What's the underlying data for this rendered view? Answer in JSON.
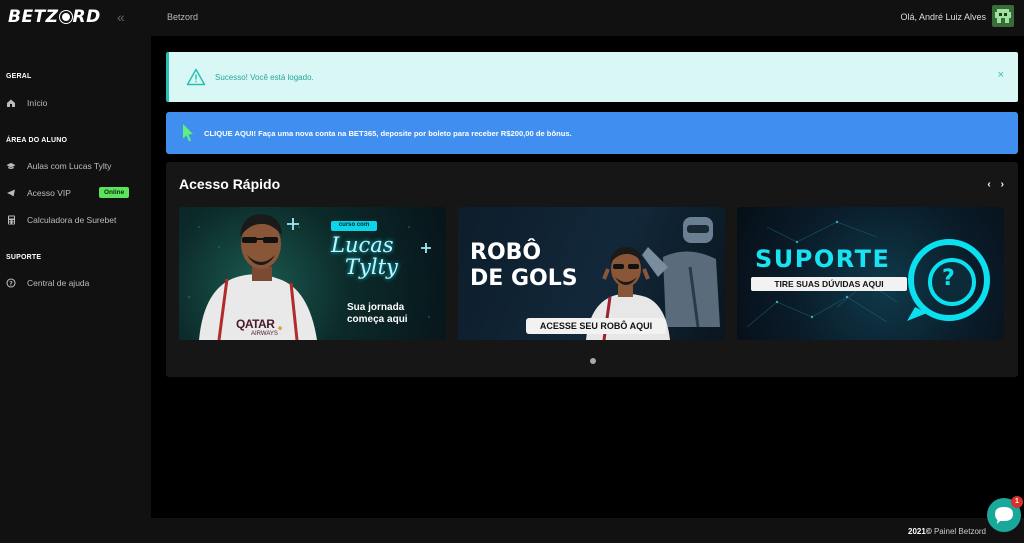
{
  "brand": {
    "logo_pre": "BETZ",
    "logo_post": "RD"
  },
  "header": {
    "breadcrumb": "Betzord",
    "greeting": "Olá, André Luiz Alves",
    "collapse_glyph": "«"
  },
  "sidebar": {
    "sections": [
      {
        "title": "GERAL",
        "items": [
          {
            "label": "Início",
            "icon": "home-icon"
          }
        ]
      },
      {
        "title": "ÁREA DO ALUNO",
        "items": [
          {
            "label": "Aulas com Lucas Tylty",
            "icon": "graduation-cap-icon"
          },
          {
            "label": "Acesso VIP",
            "icon": "telegram-icon",
            "badge": "Online"
          },
          {
            "label": "Calculadora de Surebet",
            "icon": "calculator-icon"
          }
        ]
      },
      {
        "title": "SUPORTE",
        "items": [
          {
            "label": "Central de ajuda",
            "icon": "help-circle-icon"
          }
        ]
      }
    ]
  },
  "alerts": {
    "success": {
      "message": "Sucesso! Você está logado.",
      "close": "×"
    },
    "promo": {
      "message": "CLIQUE AQUI! Faça uma nova conta na BET365, deposite por boleto para receber R$200,00 de bônus."
    }
  },
  "quick_access": {
    "title": "Acesso Rápido",
    "prev": "‹",
    "next": "›",
    "cards": [
      {
        "tag": "curso com",
        "name_1": "Lucas",
        "name_2": "Tylty",
        "caption_1": "Sua jornada",
        "caption_2": "começa aqui",
        "shirt": "QATAR",
        "shirt_sub": "AIRWAYS"
      },
      {
        "title_1": "ROBÔ",
        "title_2": "DE GOLS",
        "button": "ACESSE SEU ROBÔ AQUI"
      },
      {
        "title": "SUPORTE",
        "subtitle": "TIRE SUAS DÚVIDAS AQUI",
        "symbol": "?"
      }
    ]
  },
  "footer": {
    "year": "2021©",
    "owner": "Painel Betzord"
  },
  "chat": {
    "count": "1"
  },
  "colors": {
    "accent": "#2bbfb3",
    "promo": "#3f8ef0",
    "badge": "#5de25d",
    "chat": "#1aa89a"
  }
}
